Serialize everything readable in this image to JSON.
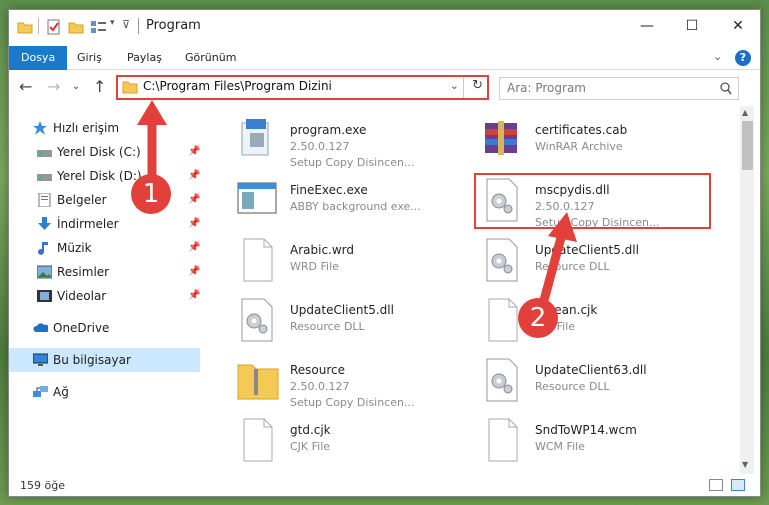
{
  "window": {
    "title": "Program",
    "controls": {
      "minimize": "—",
      "maximize": "☐",
      "close": "✕"
    }
  },
  "ribbon": {
    "tabs": [
      "Dosya",
      "Giriş",
      "Paylaş",
      "Görünüm"
    ],
    "active_tab": "Dosya",
    "expand": "⌄",
    "help": "?"
  },
  "address": {
    "path": "C:\\Program Files\\Program Dizini",
    "dropdown": "⌄",
    "refresh": "↻"
  },
  "search": {
    "placeholder": "Ara: Program",
    "icon": "search-icon"
  },
  "nav": {
    "back": "←",
    "forward": "→",
    "recent": "⌄",
    "up": "↑",
    "items": [
      {
        "label": "Hızlı erişim",
        "icon": "star-icon",
        "pinned": false,
        "level": 0
      },
      {
        "label": "Yerel Disk (C:)",
        "icon": "drive-icon",
        "pinned": true,
        "level": 1
      },
      {
        "label": "Yerel Disk (D:)",
        "icon": "drive-icon",
        "pinned": true,
        "level": 1
      },
      {
        "label": "Belgeler",
        "icon": "documents-icon",
        "pinned": true,
        "level": 1
      },
      {
        "label": "İndirmeler",
        "icon": "download-icon",
        "pinned": true,
        "level": 1
      },
      {
        "label": "Müzik",
        "icon": "music-icon",
        "pinned": true,
        "level": 1
      },
      {
        "label": "Resimler",
        "icon": "pictures-icon",
        "pinned": true,
        "level": 1
      },
      {
        "label": "Videolar",
        "icon": "videos-icon",
        "pinned": true,
        "level": 1
      },
      {
        "label": "OneDrive",
        "icon": "cloud-icon",
        "pinned": false,
        "level": 0
      },
      {
        "label": "Bu bilgisayar",
        "icon": "computer-icon",
        "pinned": false,
        "level": 0,
        "selected": true
      },
      {
        "label": "Ağ",
        "icon": "network-icon",
        "pinned": false,
        "level": 0
      }
    ]
  },
  "files": [
    {
      "name": "program.exe",
      "line1": "2.50.0.127",
      "line2": "Setup Copy Disincen...",
      "icon": "installer-icon"
    },
    {
      "name": "certificates.cab",
      "line1": "WinRAR Archive",
      "line2": "",
      "icon": "archive-icon"
    },
    {
      "name": "FineExec.exe",
      "line1": "ABBY background exe...",
      "line2": "",
      "icon": "exe-window-icon"
    },
    {
      "name": "mscpydis.dll",
      "line1": "2.50.0.127",
      "line2": "Setup Copy Disincen...",
      "icon": "dll-gear-icon"
    },
    {
      "name": "Arabic.wrd",
      "line1": "WRD File",
      "line2": "",
      "icon": "blank-file-icon"
    },
    {
      "name": "UpdateClient5.dll",
      "line1": "Resource DLL",
      "line2": "",
      "icon": "dll-gear-icon"
    },
    {
      "name": "UpdateClient5.dll",
      "line1": "Resource DLL",
      "line2": "",
      "icon": "dll-gear-icon"
    },
    {
      "name": "Korean.cjk",
      "line1": "CJK File",
      "line2": "",
      "icon": "blank-file-icon"
    },
    {
      "name": "Resource",
      "line1": "2.50.0.127",
      "line2": "Setup Copy Disincen...",
      "icon": "folder-zip-icon"
    },
    {
      "name": "UpdateClient63.dll",
      "line1": "Resource DLL",
      "line2": "",
      "icon": "dll-gear-icon"
    },
    {
      "name": "gtd.cjk",
      "line1": "CJK File",
      "line2": "",
      "icon": "blank-file-icon"
    },
    {
      "name": "SndToWP14.wcm",
      "line1": "WCM File",
      "line2": "",
      "icon": "blank-file-icon"
    }
  ],
  "status": {
    "count": "159 öğe"
  },
  "annotations": {
    "step1": "1",
    "step2": "2"
  },
  "colors": {
    "accent": "#1979ca",
    "annotation": "#e2403a",
    "selected_nav": "#cce8ff"
  }
}
